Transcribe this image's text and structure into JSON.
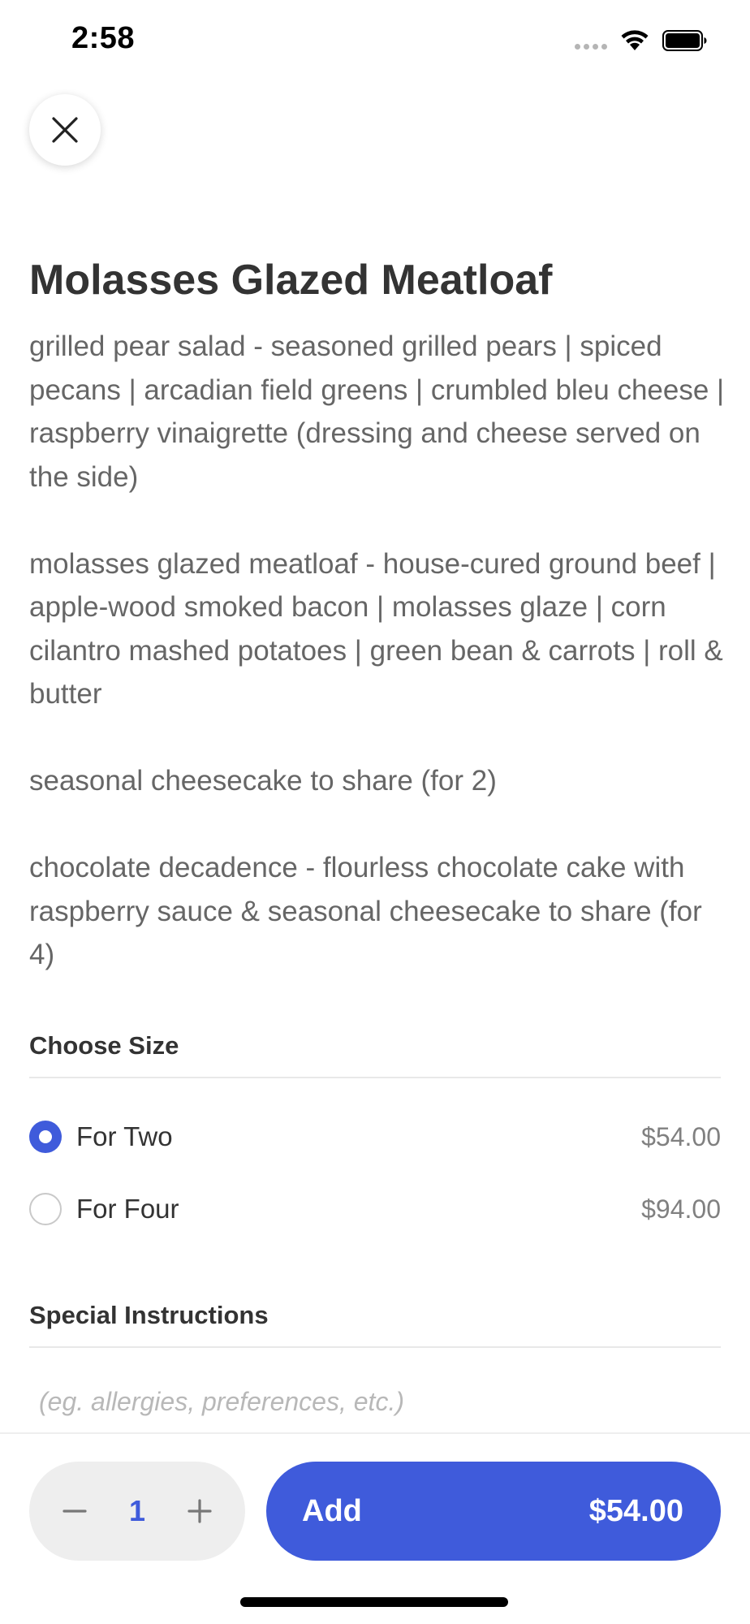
{
  "status_bar": {
    "time": "2:58"
  },
  "icons": {
    "close": "close-icon",
    "wifi": "wifi-icon",
    "battery": "battery-icon",
    "minus": "minus-icon",
    "plus": "plus-icon"
  },
  "item": {
    "title": "Molasses Glazed Meatloaf",
    "description": [
      "grilled pear salad - seasoned grilled pears | spiced pecans | arcadian field greens | crumbled bleu cheese | raspberry vinaigrette (dressing and cheese served on the side)",
      "molasses glazed meatloaf - house-cured ground beef | apple-wood smoked bacon | molasses glaze | corn cilantro mashed potatoes | green bean & carrots | roll & butter",
      "seasonal cheesecake to share (for 2)",
      "chocolate decadence - flourless chocolate cake with raspberry sauce & seasonal cheesecake to share (for 4)"
    ]
  },
  "size_section": {
    "header": "Choose Size",
    "options": [
      {
        "label": "For Two",
        "price": "$54.00",
        "selected": true
      },
      {
        "label": "For Four",
        "price": "$94.00",
        "selected": false
      }
    ]
  },
  "instructions_section": {
    "header": "Special Instructions",
    "value": "",
    "placeholder": "(eg. allergies, preferences, etc.)"
  },
  "order_bar": {
    "quantity": "1",
    "add_label": "Add",
    "add_price": "$54.00"
  },
  "colors": {
    "accent": "#3f5bdb",
    "title_text": "#333333",
    "body_text": "#666666",
    "price_text": "#808080",
    "stepper_bg": "#eeeeee"
  }
}
